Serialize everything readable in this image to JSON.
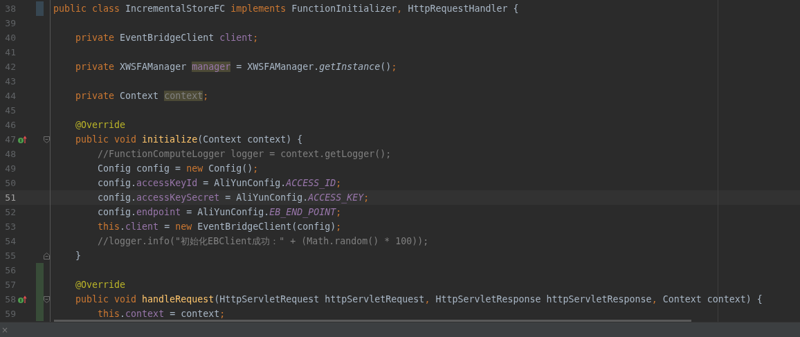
{
  "editor": {
    "lines": [
      {
        "number": "38",
        "current": false,
        "changed": true,
        "added": false,
        "gutter_icon": false,
        "fold_start": false,
        "fold_end": false,
        "tokens": [
          {
            "kind": "keyword",
            "text": "public class "
          },
          {
            "kind": "plain",
            "text": "IncrementalStoreFC "
          },
          {
            "kind": "keyword",
            "text": "implements "
          },
          {
            "kind": "plain",
            "text": "FunctionInitializer"
          },
          {
            "kind": "keyword",
            "text": ", "
          },
          {
            "kind": "plain",
            "text": "HttpRequestHandler {"
          }
        ]
      },
      {
        "number": "39",
        "current": false,
        "changed": false,
        "added": false,
        "gutter_icon": false,
        "fold_start": false,
        "fold_end": false
      },
      {
        "number": "40",
        "current": false,
        "changed": false,
        "added": false,
        "gutter_icon": false,
        "fold_start": false,
        "fold_end": false,
        "tokens": [
          {
            "kind": "keyword",
            "text": "    private "
          },
          {
            "kind": "plain",
            "text": "EventBridgeClient "
          },
          {
            "kind": "field",
            "text": "client"
          },
          {
            "kind": "keyword",
            "text": ";"
          }
        ]
      },
      {
        "number": "41",
        "current": false,
        "changed": false,
        "added": false,
        "gutter_icon": false,
        "fold_start": false,
        "fold_end": false
      },
      {
        "number": "42",
        "current": false,
        "changed": false,
        "added": false,
        "gutter_icon": false,
        "fold_start": false,
        "fold_end": false,
        "tokens": [
          {
            "kind": "keyword",
            "text": "    private "
          },
          {
            "kind": "plain",
            "text": "XWSFAManager "
          },
          {
            "kind": "field-usage",
            "text": "manager"
          },
          {
            "kind": "plain",
            "text": " = XWSFAManager."
          },
          {
            "kind": "static-method",
            "text": "getInstance"
          },
          {
            "kind": "plain",
            "text": "()"
          },
          {
            "kind": "keyword",
            "text": ";"
          }
        ]
      },
      {
        "number": "43",
        "current": false,
        "changed": false,
        "added": false,
        "gutter_icon": false,
        "fold_start": false,
        "fold_end": false
      },
      {
        "number": "44",
        "current": false,
        "changed": false,
        "added": false,
        "gutter_icon": false,
        "fold_start": false,
        "fold_end": false,
        "tokens": [
          {
            "kind": "keyword",
            "text": "    private "
          },
          {
            "kind": "plain",
            "text": "Context "
          },
          {
            "kind": "unused-usage",
            "text": "context"
          },
          {
            "kind": "keyword",
            "text": ";"
          }
        ]
      },
      {
        "number": "45",
        "current": false,
        "changed": false,
        "added": false,
        "gutter_icon": false,
        "fold_start": false,
        "fold_end": false
      },
      {
        "number": "46",
        "current": false,
        "changed": false,
        "added": false,
        "gutter_icon": false,
        "fold_start": false,
        "fold_end": false,
        "tokens": [
          {
            "kind": "annotation",
            "text": "    @Override"
          }
        ]
      },
      {
        "number": "47",
        "current": false,
        "changed": false,
        "added": false,
        "gutter_icon": true,
        "fold_start": true,
        "fold_end": false,
        "tokens": [
          {
            "kind": "keyword",
            "text": "    public void "
          },
          {
            "kind": "method",
            "text": "initialize"
          },
          {
            "kind": "plain",
            "text": "(Context context) {"
          }
        ]
      },
      {
        "number": "48",
        "current": false,
        "changed": false,
        "added": false,
        "gutter_icon": false,
        "fold_start": false,
        "fold_end": false,
        "tokens": [
          {
            "kind": "comment",
            "text": "        //FunctionComputeLogger logger = context.getLogger();"
          }
        ]
      },
      {
        "number": "49",
        "current": false,
        "changed": false,
        "added": false,
        "gutter_icon": false,
        "fold_start": false,
        "fold_end": false,
        "tokens": [
          {
            "kind": "plain",
            "text": "        Config config = "
          },
          {
            "kind": "keyword",
            "text": "new "
          },
          {
            "kind": "plain",
            "text": "Config()"
          },
          {
            "kind": "keyword",
            "text": ";"
          }
        ]
      },
      {
        "number": "50",
        "current": false,
        "changed": false,
        "added": false,
        "gutter_icon": false,
        "fold_start": false,
        "fold_end": false,
        "tokens": [
          {
            "kind": "plain",
            "text": "        config."
          },
          {
            "kind": "field",
            "text": "accessKeyId"
          },
          {
            "kind": "plain",
            "text": " = AliYunConfig."
          },
          {
            "kind": "static-field",
            "text": "ACCESS_ID"
          },
          {
            "kind": "keyword",
            "text": ";"
          }
        ]
      },
      {
        "number": "51",
        "current": true,
        "changed": false,
        "added": false,
        "gutter_icon": false,
        "fold_start": false,
        "fold_end": false,
        "tokens": [
          {
            "kind": "plain",
            "text": "        config."
          },
          {
            "kind": "field",
            "text": "accessKeySecret"
          },
          {
            "kind": "plain",
            "text": " = AliYunConfig."
          },
          {
            "kind": "static-field",
            "text": "ACCESS_KEY"
          },
          {
            "kind": "keyword",
            "text": ";"
          }
        ]
      },
      {
        "number": "52",
        "current": false,
        "changed": false,
        "added": false,
        "gutter_icon": false,
        "fold_start": false,
        "fold_end": false,
        "tokens": [
          {
            "kind": "plain",
            "text": "        config."
          },
          {
            "kind": "field",
            "text": "endpoint"
          },
          {
            "kind": "plain",
            "text": " = AliYunConfig."
          },
          {
            "kind": "static-field",
            "text": "EB_END_POINT"
          },
          {
            "kind": "keyword",
            "text": ";"
          }
        ]
      },
      {
        "number": "53",
        "current": false,
        "changed": false,
        "added": false,
        "gutter_icon": false,
        "fold_start": false,
        "fold_end": false,
        "tokens": [
          {
            "kind": "keyword",
            "text": "        this"
          },
          {
            "kind": "plain",
            "text": "."
          },
          {
            "kind": "field",
            "text": "client"
          },
          {
            "kind": "plain",
            "text": " = "
          },
          {
            "kind": "keyword",
            "text": "new "
          },
          {
            "kind": "plain",
            "text": "EventBridgeClient(config)"
          },
          {
            "kind": "keyword",
            "text": ";"
          }
        ]
      },
      {
        "number": "54",
        "current": false,
        "changed": false,
        "added": false,
        "gutter_icon": false,
        "fold_start": false,
        "fold_end": false,
        "tokens": [
          {
            "kind": "comment",
            "text": "        //logger.info(\"初始化EBClient成功：\" + (Math.random() * 100));"
          }
        ]
      },
      {
        "number": "55",
        "current": false,
        "changed": false,
        "added": false,
        "gutter_icon": false,
        "fold_start": false,
        "fold_end": true,
        "tokens": [
          {
            "kind": "plain",
            "text": "    }"
          }
        ]
      },
      {
        "number": "56",
        "current": false,
        "changed": false,
        "added": true,
        "gutter_icon": false,
        "fold_start": false,
        "fold_end": false
      },
      {
        "number": "57",
        "current": false,
        "changed": false,
        "added": true,
        "gutter_icon": false,
        "fold_start": false,
        "fold_end": false,
        "tokens": [
          {
            "kind": "annotation",
            "text": "    @Override"
          }
        ]
      },
      {
        "number": "58",
        "current": false,
        "changed": false,
        "added": true,
        "gutter_icon": true,
        "fold_start": true,
        "fold_end": false,
        "tokens": [
          {
            "kind": "keyword",
            "text": "    public void "
          },
          {
            "kind": "method",
            "text": "handleRequest"
          },
          {
            "kind": "plain",
            "text": "(HttpServletRequest httpServletRequest"
          },
          {
            "kind": "keyword",
            "text": ", "
          },
          {
            "kind": "plain",
            "text": "HttpServletResponse httpServletResponse"
          },
          {
            "kind": "keyword",
            "text": ", "
          },
          {
            "kind": "plain",
            "text": "Context context) {"
          }
        ]
      },
      {
        "number": "59",
        "current": false,
        "changed": false,
        "added": true,
        "gutter_icon": false,
        "fold_start": false,
        "fold_end": false,
        "tokens": [
          {
            "kind": "keyword",
            "text": "        this"
          },
          {
            "kind": "plain",
            "text": "."
          },
          {
            "kind": "field",
            "text": "context"
          },
          {
            "kind": "plain",
            "text": " = context"
          },
          {
            "kind": "keyword",
            "text": ";"
          }
        ]
      }
    ]
  },
  "bottom_panel": {
    "close": "×"
  }
}
